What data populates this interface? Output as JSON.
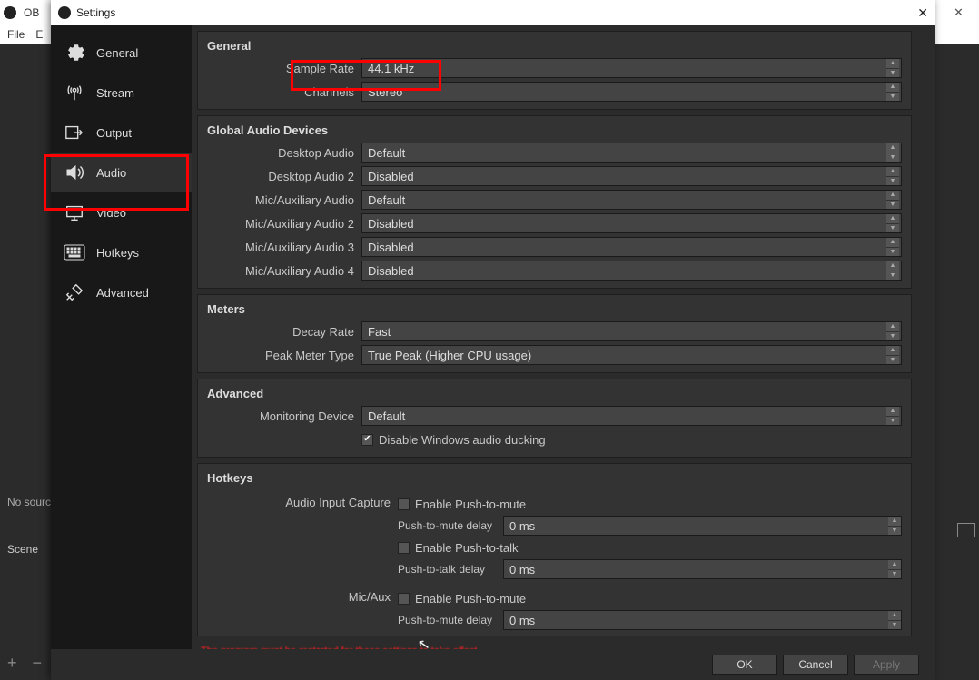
{
  "bg": {
    "title_fragment": "OB",
    "menu_file": "File",
    "menu_e": "E",
    "no_source": "No sourc",
    "scene": "Scene",
    "plusminus": "+  −"
  },
  "dialog": {
    "title": "Settings",
    "close": "✕"
  },
  "sidebar": {
    "items": [
      {
        "label": "General"
      },
      {
        "label": "Stream"
      },
      {
        "label": "Output"
      },
      {
        "label": "Audio"
      },
      {
        "label": "Video"
      },
      {
        "label": "Hotkeys"
      },
      {
        "label": "Advanced"
      }
    ]
  },
  "sections": {
    "general": {
      "title": "General",
      "sample_rate_label": "Sample Rate",
      "sample_rate_value": "44.1 kHz",
      "channels_label": "Channels",
      "channels_value": "Stereo"
    },
    "devices": {
      "title": "Global Audio Devices",
      "rows": [
        {
          "label": "Desktop Audio",
          "value": "Default"
        },
        {
          "label": "Desktop Audio 2",
          "value": "Disabled"
        },
        {
          "label": "Mic/Auxiliary Audio",
          "value": "Default"
        },
        {
          "label": "Mic/Auxiliary Audio 2",
          "value": "Disabled"
        },
        {
          "label": "Mic/Auxiliary Audio 3",
          "value": "Disabled"
        },
        {
          "label": "Mic/Auxiliary Audio 4",
          "value": "Disabled"
        }
      ]
    },
    "meters": {
      "title": "Meters",
      "decay_label": "Decay Rate",
      "decay_value": "Fast",
      "peak_label": "Peak Meter Type",
      "peak_value": "True Peak (Higher CPU usage)"
    },
    "advanced": {
      "title": "Advanced",
      "monitor_label": "Monitoring Device",
      "monitor_value": "Default",
      "ducking": "Disable Windows audio ducking"
    },
    "hotkeys": {
      "title": "Hotkeys",
      "audio_input_label": "Audio Input Capture",
      "micaux_label": "Mic/Aux",
      "enable_ptm": "Enable Push-to-mute",
      "ptm_delay_label": "Push-to-mute delay",
      "ptm_delay_value": "0 ms",
      "enable_ptt": "Enable Push-to-talk",
      "ptt_delay_label": "Push-to-talk delay",
      "ptt_delay_value": "0 ms"
    }
  },
  "warning": "The program must be restarted for these settings to take effect.",
  "footer": {
    "ok": "OK",
    "cancel": "Cancel",
    "apply": "Apply"
  }
}
